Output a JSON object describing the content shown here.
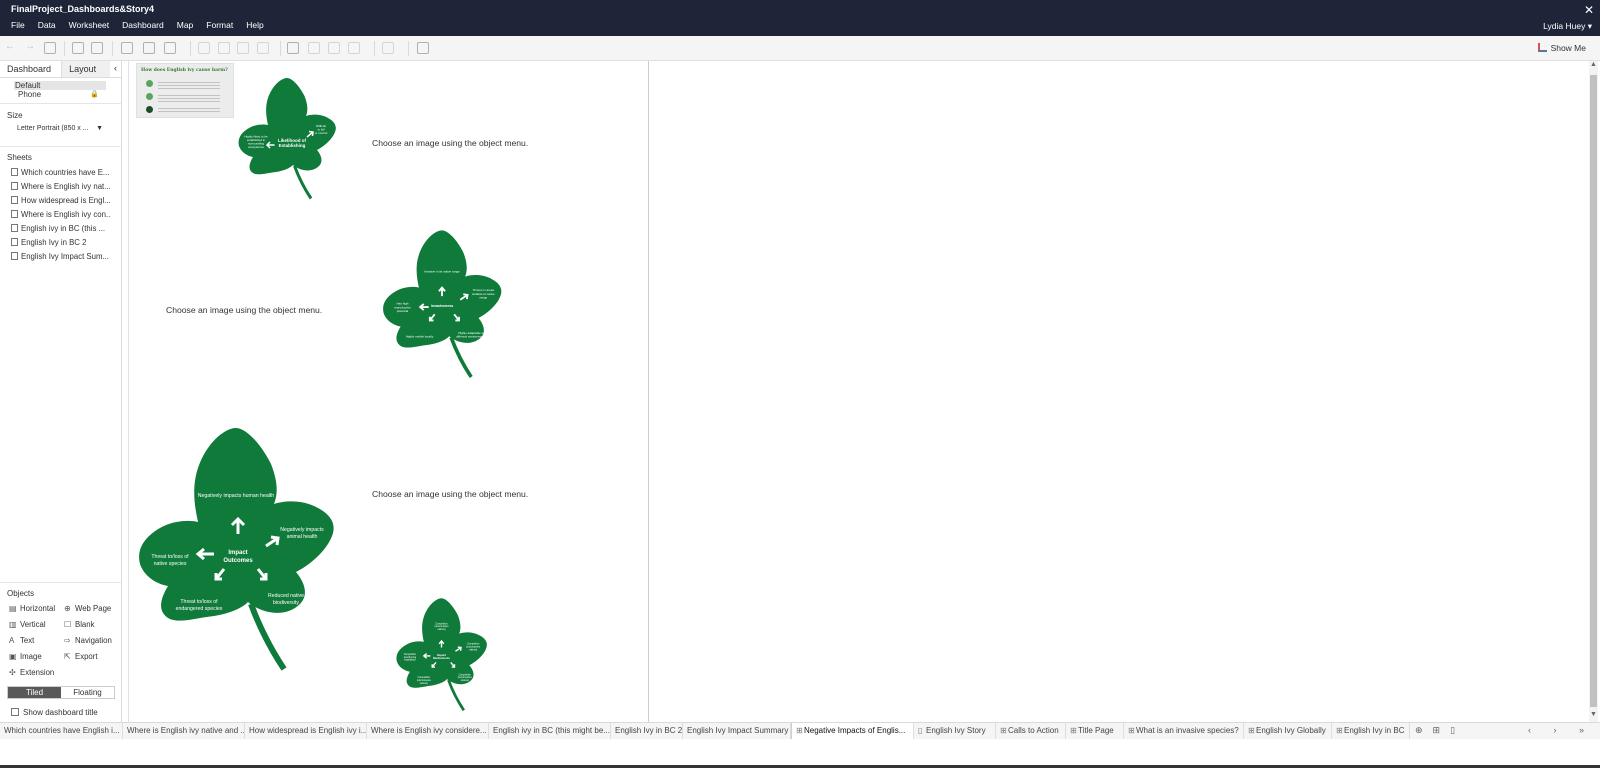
{
  "app": {
    "title": "FinalProject_Dashboards&Story4",
    "user": "Lydia Huey",
    "close_glyph": "✕",
    "menus": [
      "File",
      "Data",
      "Worksheet",
      "Dashboard",
      "Map",
      "Format",
      "Help"
    ],
    "show_me": "Show Me"
  },
  "panel": {
    "tab_dashboard": "Dashboard",
    "tab_layout": "Layout",
    "device_default": "Default",
    "device_phone": "Phone",
    "size_label": "Size",
    "size_value": "Letter Portrait (850 x ...",
    "sheets_label": "Sheets",
    "sheets": [
      "Which countries have E...",
      "Where is English ivy nat...",
      "How widespread is Engl...",
      "Where is English ivy con...",
      "English ivy in BC (this ...",
      "English Ivy in BC 2",
      "English Ivy Impact Sum..."
    ],
    "objects_label": "Objects",
    "objects": {
      "horizontal": "Horizontal",
      "web_page": "Web Page",
      "vertical": "Vertical",
      "blank": "Blank",
      "text": "Text",
      "navigation": "Navigation",
      "image": "Image",
      "export": "Export",
      "extension": "Extension"
    },
    "tiled": "Tiled",
    "floating": "Floating",
    "show_title": "Show dashboard title"
  },
  "canvas": {
    "placeholder": "Choose an image using the object menu.",
    "thumb_title": "How does English ivy cause harm?",
    "leaf_small_1": {
      "center": [
        "Likelihood of",
        "Establishing"
      ],
      "left": [
        "Highly likely to be",
        "established in",
        "surrounding",
        "ecosystems"
      ],
      "right": [
        "Difficult",
        "to kill",
        "or control"
      ]
    },
    "leaf_mid": {
      "center": "Invasiveness",
      "top": "Invasive in its native range",
      "left": [
        "Has high",
        "reproductive",
        "potential"
      ],
      "right": [
        "Thrives in areas",
        "suitable to native",
        "range"
      ],
      "bottom_left": "Highly mobile locally",
      "bottom_right": [
        "Highly adaptable to",
        "different environments"
      ]
    },
    "leaf_large": {
      "center": [
        "Impact",
        "Outcomes"
      ],
      "top": "Negatively impacts human health",
      "right": [
        "Negatively impacts",
        "animal health"
      ],
      "left": [
        "Threat to/loss of",
        "native species"
      ],
      "bottom_left": [
        "Threat to/loss of",
        "endangered species"
      ],
      "bottom_right": [
        "Reduced native",
        "biodiversity"
      ]
    },
    "leaf_small_2": {
      "center": [
        "Impact",
        "Mechanisms"
      ],
      "top": [
        "Competition",
        "(outcompetes",
        "natives)"
      ],
      "left": [
        "Competition",
        "(smothering",
        "vegetation)"
      ],
      "right": [
        "Competition",
        "(outcompetes",
        "natives)"
      ],
      "bottom_left": [
        "Competition",
        "(outcompetes",
        "natives)"
      ],
      "bottom_right": [
        "Competition",
        "(outcompetes",
        "natives)"
      ]
    }
  },
  "bottom_tabs": [
    "Which countries have English i...",
    "Where is English ivy native and ...",
    "How widespread is English ivy i...",
    "Where is English ivy considere...",
    "English ivy in BC (this might be...",
    "English Ivy in BC 2",
    "English Ivy Impact Summary",
    "Negative Impacts of Englis...",
    "English Ivy Story",
    "Calls to Action",
    "Title Page",
    "What is an invasive species?",
    "English Ivy Globally",
    "English Ivy in BC"
  ],
  "colors": {
    "titlebar": "#1f2538",
    "leaf": "#0f7a3a",
    "active_toggle": "#595959"
  }
}
